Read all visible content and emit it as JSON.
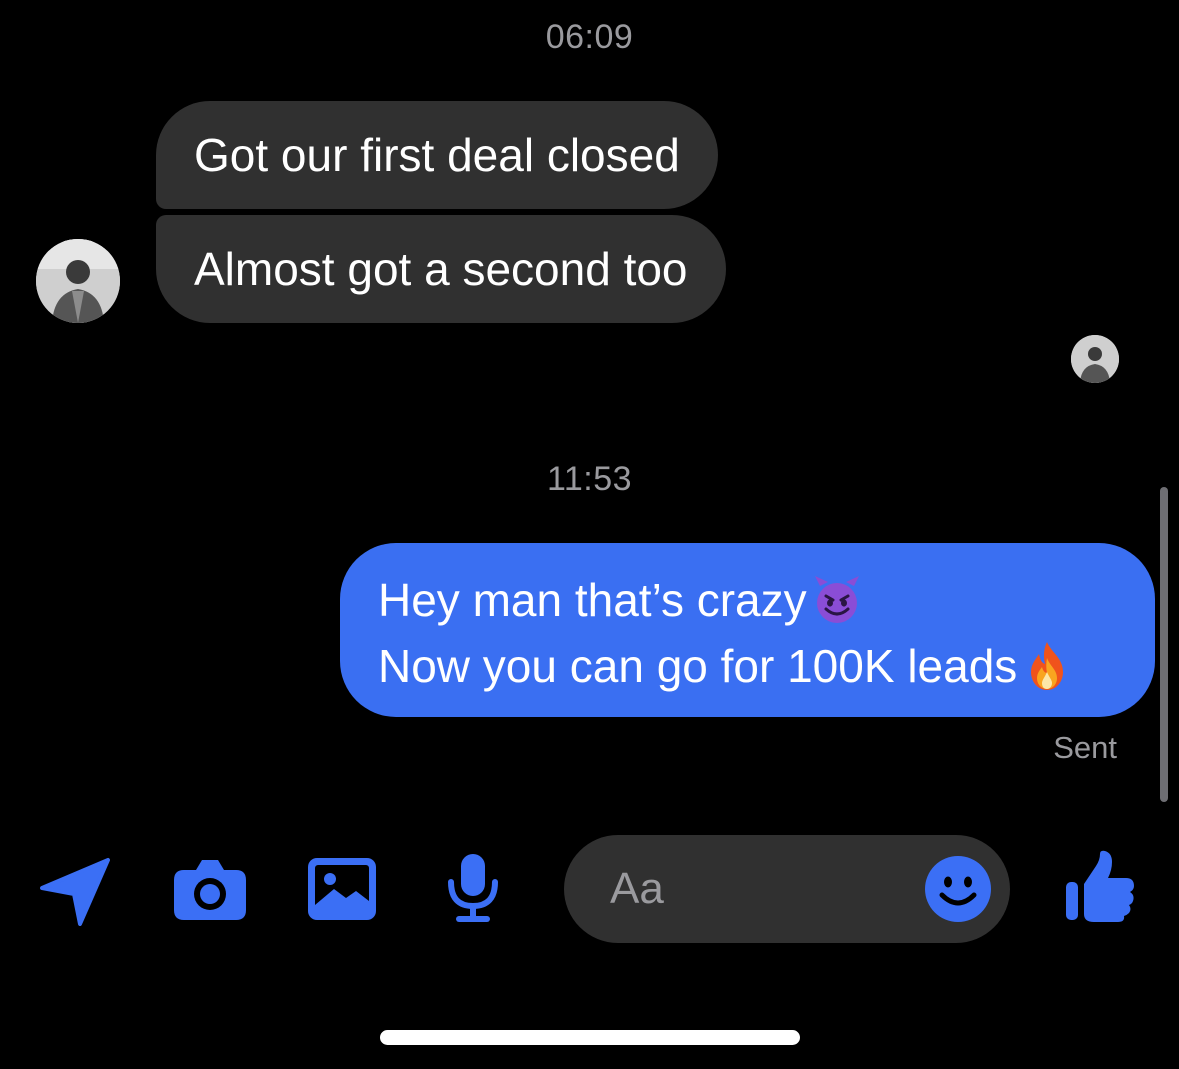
{
  "conversation": {
    "timestamps": [
      "06:09",
      "11:53"
    ],
    "incoming": [
      {
        "text": "Got our first deal closed"
      },
      {
        "text": "Almost got a second too"
      }
    ],
    "outgoing": {
      "lines": [
        {
          "text": "Hey man that’s crazy",
          "emoji": "smiling-imp"
        },
        {
          "text": "Now you can go for 100K leads",
          "emoji": "fire"
        }
      ],
      "status": "Sent"
    }
  },
  "composer": {
    "placeholder": "Aa",
    "value": ""
  },
  "toolbar": {
    "icons": [
      "location-arrow-icon",
      "camera-icon",
      "gallery-icon",
      "microphone-icon",
      "emoji-icon",
      "thumbs-up-icon"
    ]
  },
  "colors": {
    "background": "#000000",
    "incoming_bubble": "#303030",
    "outgoing_bubble": "#3a6ff2",
    "accent": "#3b6ff5",
    "muted_text": "#9a9a9e"
  }
}
